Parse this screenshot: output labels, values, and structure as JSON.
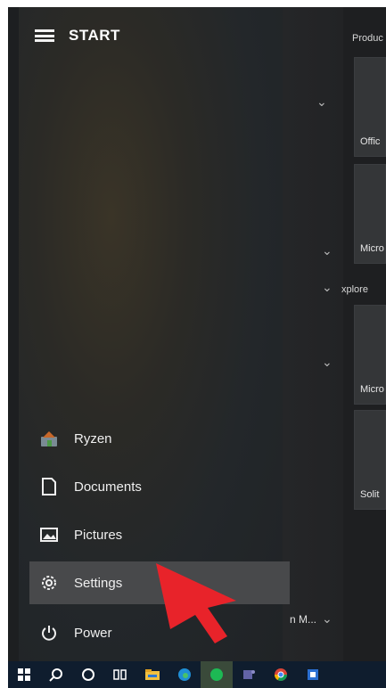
{
  "header": {
    "title": "START"
  },
  "groups": [
    {
      "label": "Produc"
    },
    {
      "label": "xplore"
    }
  ],
  "tiles": [
    {
      "label": "Offic"
    },
    {
      "label": "Micro"
    },
    {
      "label": "Micro"
    },
    {
      "label": "Solit"
    }
  ],
  "sidebar": {
    "items": [
      {
        "label": "Ryzen",
        "icon": "user-avatar-icon"
      },
      {
        "label": "Documents",
        "icon": "document-icon"
      },
      {
        "label": "Pictures",
        "icon": "pictures-icon"
      },
      {
        "label": "Settings",
        "icon": "gear-icon",
        "highlighted": true
      },
      {
        "label": "Power",
        "icon": "power-icon"
      }
    ]
  },
  "app_list_tail": {
    "label": "n M..."
  },
  "taskbar": {
    "icons": [
      "windows-start-icon",
      "search-icon",
      "cortana-icon",
      "task-view-icon",
      "file-explorer-icon",
      "edge-icon",
      "spotify-icon",
      "teams-icon",
      "chrome-icon",
      "app-icon"
    ]
  },
  "colors": {
    "start_bg": "#202326",
    "highlight": "#48494b",
    "arrow": "#e8232a",
    "taskbar": "#0f1d2e"
  }
}
